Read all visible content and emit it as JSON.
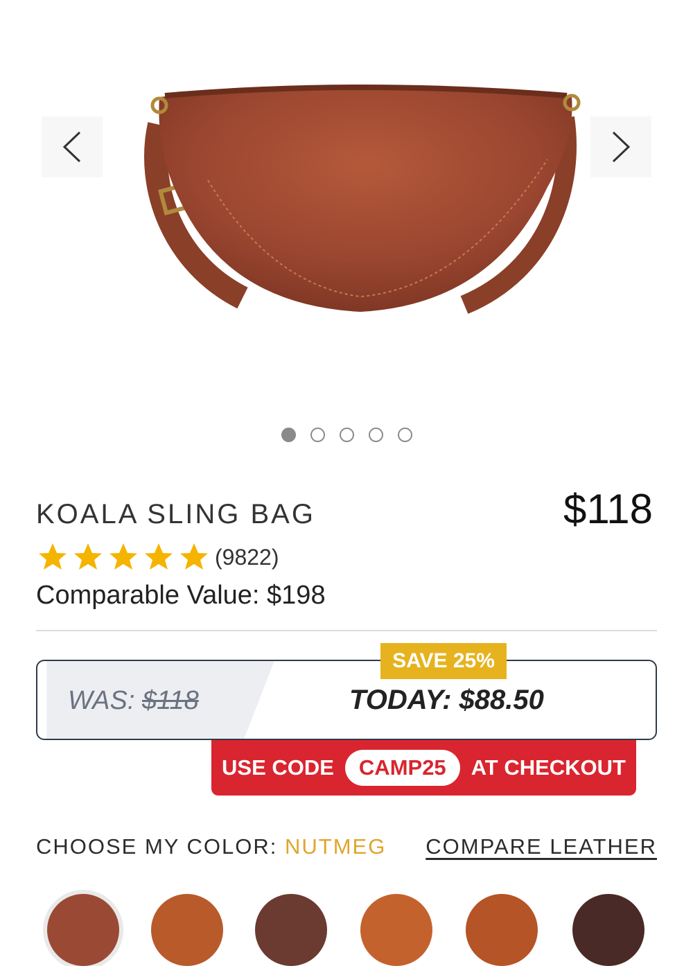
{
  "product": {
    "name": "KOALA SLING BAG",
    "price": "$118",
    "rating": 5,
    "review_count": "(9822)",
    "comparable_value": "Comparable Value: $198"
  },
  "gallery": {
    "image_count": 5,
    "active_index": 0
  },
  "promo": {
    "badge": "SAVE 25%",
    "was_label": "WAS: ",
    "was_price": "$118",
    "today": "TODAY: $88.50",
    "code_prefix": "USE CODE",
    "code": "CAMP25",
    "code_suffix": "AT CHECKOUT"
  },
  "color_picker": {
    "label": "CHOOSE MY COLOR: ",
    "selected": "NUTMEG",
    "compare_link": "COMPARE LEATHER",
    "swatch_colors": [
      "#9a4a34",
      "#b85a2a",
      "#6b3a30",
      "#c4622e",
      "#b55426",
      "#4a2a26"
    ]
  },
  "colors": {
    "accent_gold": "#e6b31e",
    "promo_red": "#d9252f",
    "star_yellow": "#f5b400"
  }
}
